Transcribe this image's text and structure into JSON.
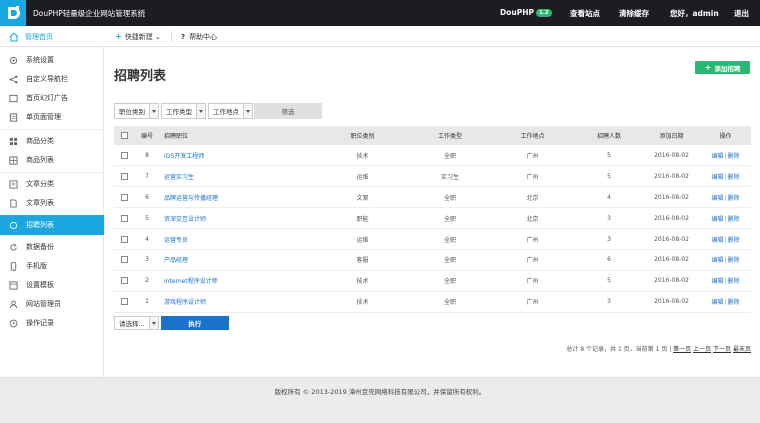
{
  "app": {
    "title": "DouPHP轻量级企业网站管理系统",
    "product": "DouPHP",
    "version": "1.2",
    "view_site": "查看站点",
    "clear_cache": "清除缓存",
    "greeting": "您好，admin",
    "logout": "退出"
  },
  "subheader": {
    "home_tab": "管理首页",
    "quick_new": "快捷新建",
    "help_center": "帮助中心"
  },
  "sidebar": {
    "items": [
      {
        "label": "系统设置",
        "icon": "gear-icon"
      },
      {
        "label": "自定义导航栏",
        "icon": "share-icon"
      },
      {
        "label": "首页幻灯广告",
        "icon": "slideshow-icon"
      },
      {
        "label": "单页面管理",
        "icon": "page-icon"
      },
      {
        "label": "商品分类",
        "icon": "category-icon"
      },
      {
        "label": "商品列表",
        "icon": "list-icon"
      },
      {
        "label": "文章分类",
        "icon": "category-icon"
      },
      {
        "label": "文章列表",
        "icon": "document-icon"
      },
      {
        "label": "招聘列表",
        "icon": "circle-icon"
      },
      {
        "label": "数据备份",
        "icon": "refresh-icon"
      },
      {
        "label": "手机版",
        "icon": "mobile-icon"
      },
      {
        "label": "设置模板",
        "icon": "template-icon"
      },
      {
        "label": "网站管理员",
        "icon": "user-icon"
      },
      {
        "label": "操作记录",
        "icon": "clock-icon"
      }
    ],
    "active_index": 8
  },
  "main": {
    "title": "招聘列表",
    "add_button": "添加招聘",
    "filters": [
      "职位类别",
      "工作类型",
      "工作地点"
    ],
    "filter_button": "筛选",
    "columns": [
      "编号",
      "招聘职位",
      "职位类别",
      "工作类型",
      "工作地点",
      "招聘人数",
      "添加日期",
      "操作"
    ],
    "rows": [
      {
        "id": "8",
        "title": "iOS开发工程师",
        "category": "技术",
        "type": "全职",
        "location": "广州",
        "count": "5",
        "date": "2016-08-02"
      },
      {
        "id": "7",
        "title": "运营实习生",
        "category": "运维",
        "type": "实习生",
        "location": "广州",
        "count": "5",
        "date": "2016-08-02"
      },
      {
        "id": "6",
        "title": "品牌运营与传播经理",
        "category": "文案",
        "type": "全职",
        "location": "北京",
        "count": "4",
        "date": "2016-08-02"
      },
      {
        "id": "5",
        "title": "资深交互设计师",
        "category": "职能",
        "type": "全职",
        "location": "北京",
        "count": "3",
        "date": "2016-08-02"
      },
      {
        "id": "4",
        "title": "运营专员",
        "category": "运维",
        "type": "全职",
        "location": "广州",
        "count": "3",
        "date": "2016-08-02"
      },
      {
        "id": "3",
        "title": "产品经理",
        "category": "客服",
        "type": "全职",
        "location": "广州",
        "count": "6",
        "date": "2016-08-02"
      },
      {
        "id": "2",
        "title": "internet程序设计师",
        "category": "技术",
        "type": "全职",
        "location": "广州",
        "count": "5",
        "date": "2016-08-02"
      },
      {
        "id": "1",
        "title": "游戏程序设计师",
        "category": "技术",
        "type": "全职",
        "location": "广州",
        "count": "3",
        "date": "2016-08-02"
      }
    ],
    "op_edit": "编辑",
    "op_delete": "删除",
    "bulk_select": "请选择...",
    "execute_button": "执行",
    "pager": {
      "summary": "总计 8 个记录，共 1 页，当前第 1 页 |",
      "first": "第一页",
      "prev": "上一页",
      "next": "下一页",
      "last": "最末页"
    }
  },
  "footer": {
    "copyright": "版权所有 © 2013-2019 漳州豆壳网络科技有限公司，并保留所有权利。"
  },
  "colors": {
    "topbar": "#1b1d22",
    "accent": "#1aa7e0",
    "green": "#2bb673",
    "primary": "#1a73c8"
  }
}
